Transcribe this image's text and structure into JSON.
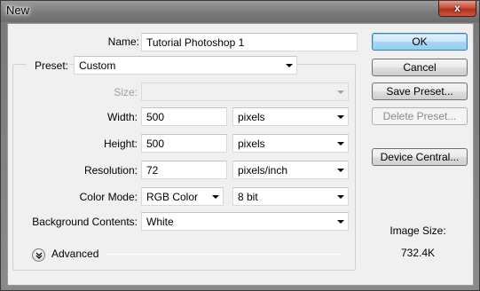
{
  "window": {
    "title": "New",
    "close_label": "x"
  },
  "form": {
    "name_label": "Name:",
    "name_value": "Tutorial Photoshop 1",
    "preset_label": "Preset:",
    "preset_value": "Custom",
    "size_label": "Size:",
    "size_value": "",
    "width_label": "Width:",
    "width_value": "500",
    "width_unit": "pixels",
    "height_label": "Height:",
    "height_value": "500",
    "height_unit": "pixels",
    "resolution_label": "Resolution:",
    "resolution_value": "72",
    "resolution_unit": "pixels/inch",
    "color_mode_label": "Color Mode:",
    "color_mode_value": "RGB Color",
    "bit_depth_value": "8 bit",
    "background_label": "Background Contents:",
    "background_value": "White",
    "advanced_label": "Advanced"
  },
  "buttons": {
    "ok": "OK",
    "cancel": "Cancel",
    "save_preset": "Save Preset...",
    "delete_preset": "Delete Preset...",
    "device_central": "Device Central..."
  },
  "info": {
    "image_size_label": "Image Size:",
    "image_size_value": "732.4K"
  },
  "icons": {
    "advanced_toggle": "chevron-down-double-icon",
    "select_arrow": "chevron-down-icon"
  },
  "colors": {
    "default_button": "#a7d6f2",
    "close_button": "#c8513c"
  }
}
